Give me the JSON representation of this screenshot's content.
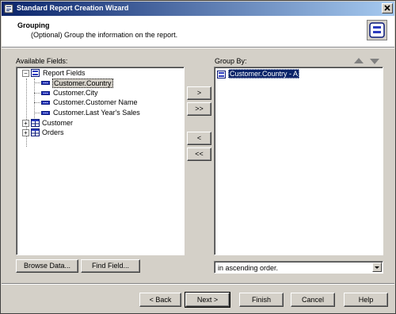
{
  "window": {
    "title": "Standard Report Creation Wizard"
  },
  "header": {
    "title": "Grouping",
    "subtitle": "(Optional) Group the information on the report."
  },
  "available_fields": {
    "label": "Available Fields:",
    "tree": {
      "report_fields": "Report Fields",
      "fields": [
        "Customer.Country",
        "Customer.City",
        "Customer.Customer Name",
        "Customer.Last Year's Sales"
      ],
      "selected": "Customer.Country",
      "customer": "Customer",
      "orders": "Orders"
    },
    "browse_data": "Browse Data...",
    "find_field": "Find Field..."
  },
  "transfer": {
    "add_one": ">",
    "add_all": ">>",
    "remove_one": "<",
    "remove_all": "<<"
  },
  "group_by": {
    "label": "Group By:",
    "items": [
      "Customer.Country - A"
    ],
    "order_value": "in ascending order."
  },
  "footer": {
    "back": "< Back",
    "next": "Next >",
    "finish": "Finish",
    "cancel": "Cancel",
    "help": "Help"
  },
  "icons": {
    "app": "report-wizard-icon",
    "header": "grouping-icon",
    "tree_folder": "report-fields-icon",
    "field": "database-field-icon",
    "table": "table-icon"
  },
  "colors": {
    "title_start": "#0a246a",
    "title_end": "#a6caf0",
    "face": "#d4d0c8",
    "field_icon": "#2b3bbf"
  }
}
